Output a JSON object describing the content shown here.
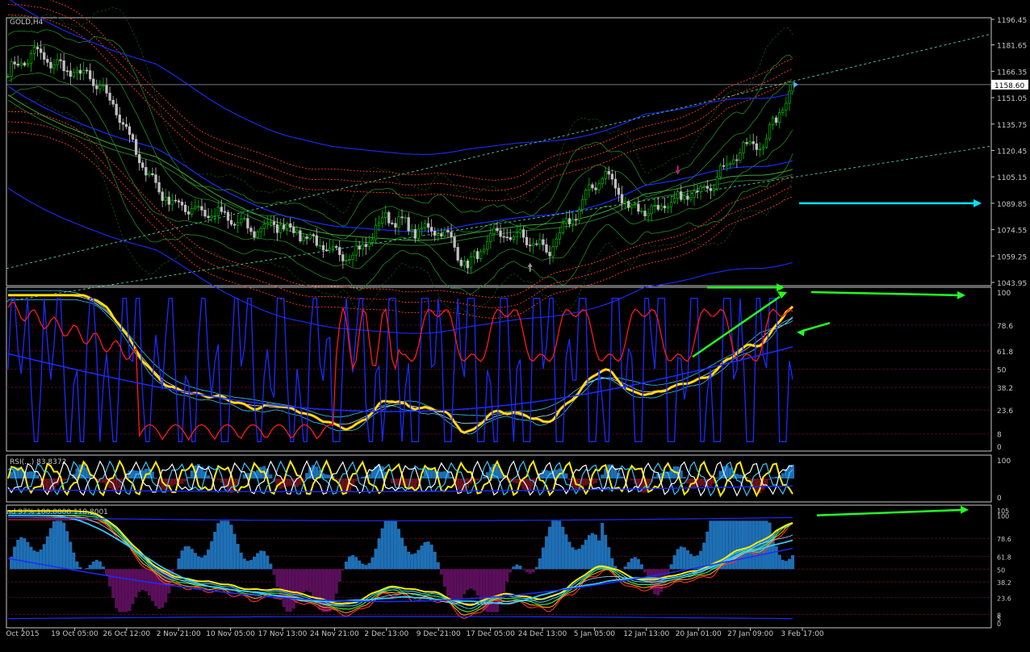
{
  "colors": {
    "background": "#000000",
    "axis": "#c8c8c8",
    "grid": "#5a0a3a",
    "candle_up": "#00c000",
    "candle_down": "#c0c0c0",
    "bb_green": "#1f8a1f",
    "bb_dark_green": "#0d4d0d",
    "red_dotted": "#ff3b1a",
    "blue": "#1a2cff",
    "trend_dashed": "#4fd0a0",
    "annot_cyan": "#00e5ff",
    "annot_green": "#22ff22",
    "yellow": "#ffee00",
    "stoch_red": "#ff1a1a",
    "cyan_line": "#35c8ff",
    "hist_blue": "#1e6fb5",
    "hist_purple": "#5a0f5a",
    "arrow_magenta": "#c0208a",
    "arrow_gray": "#9a9a9a"
  },
  "panel_labels": {
    "main": "GOLD,H4",
    "rsi": "RSI(...) 83.8372",
    "osc": "nd 97% 100.0000 110.8001"
  },
  "icons": {
    "current_price_marker": "price-arrow-icon",
    "fractal_up": "arrow-up-icon",
    "fractal_down": "arrow-down-icon"
  },
  "chart_data": [
    {
      "type": "candlestick",
      "symbol": "GOLD",
      "timeframe": "H4",
      "ylim": [
        1043.95,
        1196.45
      ],
      "y_ticks": [
        "1196.45",
        "1181.65",
        "1166.35",
        "1151.05",
        "1135.75",
        "1120.45",
        "1105.15",
        "1089.85",
        "1074.55",
        "1059.25",
        "1043.95"
      ],
      "current_price": "1158.60",
      "x_ticks": [
        "Oct 2015",
        "19 Oct 05:00",
        "26 Oct 12:00",
        "2 Nov 21:00",
        "10 Nov 05:00",
        "17 Nov 13:00",
        "24 Nov 21:00",
        "2 Dec 13:00",
        "9 Dec 21:00",
        "17 Dec 05:00",
        "24 Dec 13:00",
        "5 Jan 05:00",
        "12 Jan 13:00",
        "20 Jan 01:00",
        "27 Jan 09:00",
        "3 Feb 17:00"
      ],
      "close_path": [
        {
          "x": "Oct 2015",
          "y": 1166
        },
        {
          "x": "19 Oct 05:00",
          "y": 1177
        },
        {
          "x": "22 Oct",
          "y": 1168
        },
        {
          "x": "26 Oct 12:00",
          "y": 1163
        },
        {
          "x": "29 Oct",
          "y": 1145
        },
        {
          "x": "2 Nov 21:00",
          "y": 1110
        },
        {
          "x": "6 Nov",
          "y": 1090
        },
        {
          "x": "10 Nov 05:00",
          "y": 1086
        },
        {
          "x": "13 Nov",
          "y": 1082
        },
        {
          "x": "17 Nov 13:00",
          "y": 1074
        },
        {
          "x": "20 Nov",
          "y": 1078
        },
        {
          "x": "24 Nov 21:00",
          "y": 1071
        },
        {
          "x": "27 Nov",
          "y": 1060
        },
        {
          "x": "2 Dec 13:00",
          "y": 1062
        },
        {
          "x": "4 Dec",
          "y": 1083
        },
        {
          "x": "9 Dec 21:00",
          "y": 1074
        },
        {
          "x": "13 Dec",
          "y": 1075
        },
        {
          "x": "17 Dec 05:00",
          "y": 1053
        },
        {
          "x": "20 Dec",
          "y": 1072
        },
        {
          "x": "24 Dec 13:00",
          "y": 1070
        },
        {
          "x": "29 Dec",
          "y": 1062
        },
        {
          "x": "5 Jan 05:00",
          "y": 1085
        },
        {
          "x": "7 Jan",
          "y": 1108
        },
        {
          "x": "12 Jan 13:00",
          "y": 1087
        },
        {
          "x": "15 Jan",
          "y": 1086
        },
        {
          "x": "20 Jan 01:00",
          "y": 1093
        },
        {
          "x": "23 Jan",
          "y": 1102
        },
        {
          "x": "27 Jan 09:00",
          "y": 1120
        },
        {
          "x": "1 Feb",
          "y": 1126
        },
        {
          "x": "3 Feb 17:00",
          "y": 1158.6
        }
      ]
    },
    {
      "type": "line",
      "name": "stochastic_panel",
      "ylim": [
        0,
        100
      ],
      "y_ticks": [
        "100",
        "78.6",
        "61.8",
        "50",
        "38.2",
        "23.6",
        "8",
        "0"
      ]
    },
    {
      "type": "line",
      "name": "rsi_panel",
      "ylim": [
        0,
        100
      ],
      "y_ticks": [
        "100",
        "0"
      ],
      "value": 83.8372
    },
    {
      "type": "line",
      "name": "oscillator_panel",
      "ylim": [
        0,
        105
      ],
      "y_ticks": [
        "105",
        "100",
        "78.6",
        "61.8",
        "50",
        "38.2",
        "23.6",
        "8",
        "5",
        "0"
      ]
    }
  ]
}
